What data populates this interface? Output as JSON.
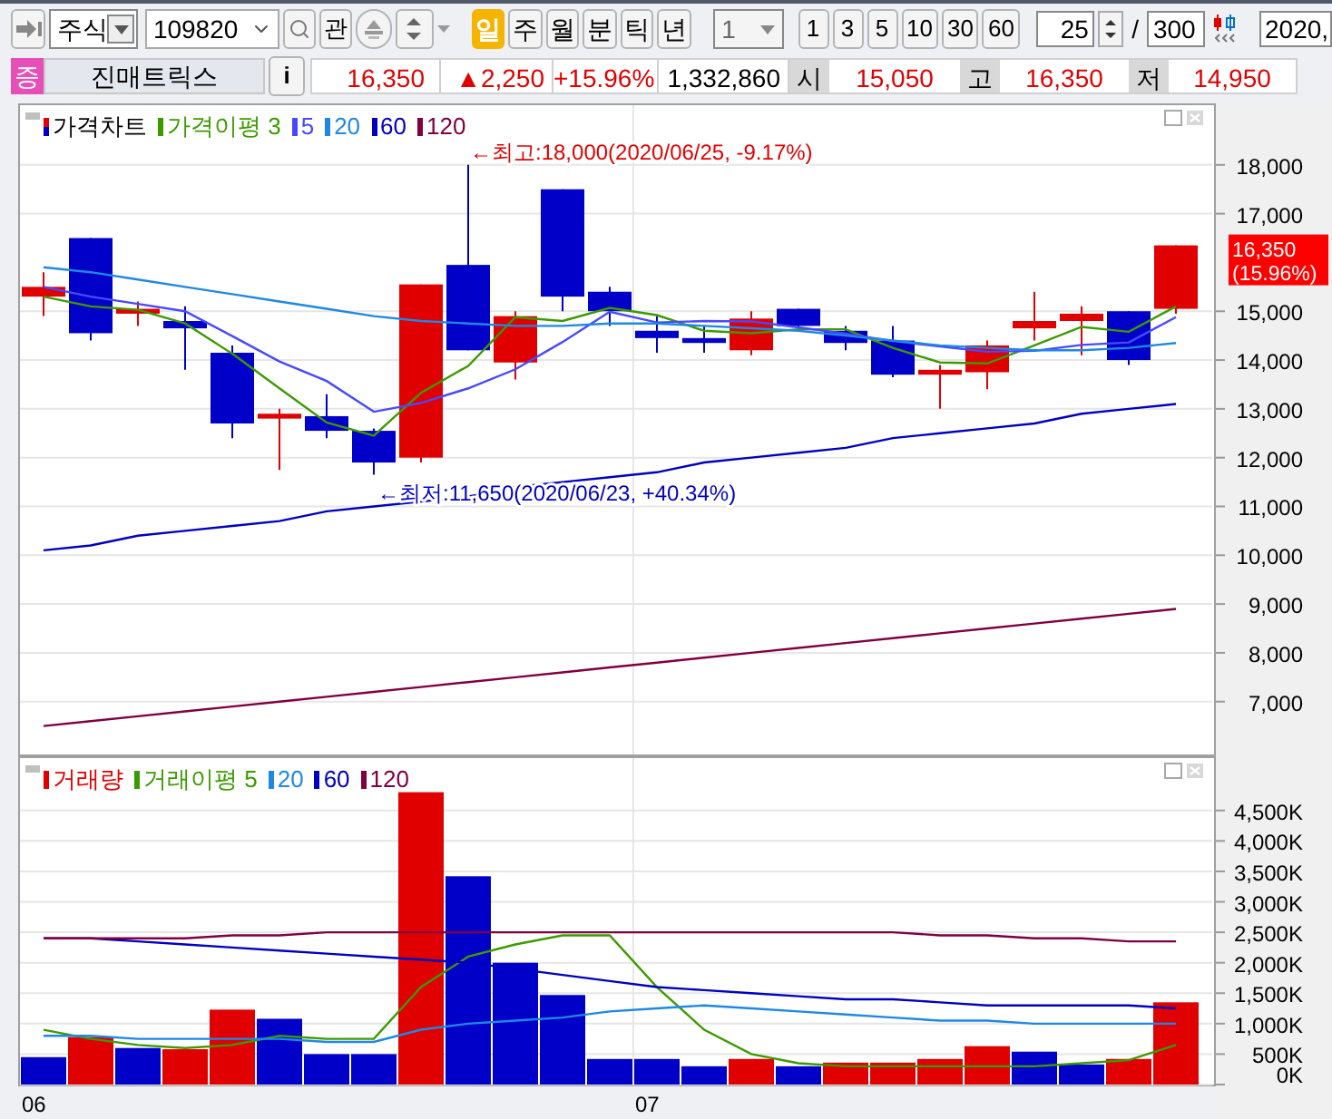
{
  "toolbar": {
    "market": "주식",
    "code": "109820",
    "watch_button": "관",
    "periods": [
      {
        "label": "일",
        "selected": true
      },
      {
        "label": "주",
        "selected": false
      },
      {
        "label": "월",
        "selected": false
      },
      {
        "label": "분",
        "selected": false
      },
      {
        "label": "틱",
        "selected": false
      },
      {
        "label": "년",
        "selected": false
      }
    ],
    "unit": "1",
    "intervals": [
      "1",
      "3",
      "5",
      "10",
      "30",
      "60"
    ],
    "count": "25",
    "separator": "/",
    "total": "300",
    "date": "2020,"
  },
  "quote": {
    "badge": "증",
    "name": "진매트릭스",
    "info_button": "i",
    "price": "16,350",
    "change": "▲2,250",
    "change_rate": "+15.96%",
    "volume": "1,332,860",
    "open_label": "시",
    "open": "15,050",
    "high_label": "고",
    "high": "16,350",
    "low_label": "저",
    "low": "14,950"
  },
  "price_panel": {
    "current_price": "16,350",
    "current_rate": "(15.96%)",
    "chart_data": {
      "type": "line",
      "grid": true,
      "legend": "upper left",
      "series": [
        {
          "name": "가격차트",
          "type": "candlestick",
          "colors": [
            "#e00000",
            "#0000c8",
            "#e00000",
            "#0000c8",
            "#0000c8",
            "#e00000",
            "#0000c8",
            "#0000c8",
            "#e00000",
            "#0000c8",
            "#e00000",
            "#0000c8",
            "#0000c8",
            "#0000c8",
            "#0000c8",
            "#e00000",
            "#0000c8",
            "#0000c8",
            "#0000c8",
            "#e00000",
            "#e00000",
            "#e00000",
            "#e00000",
            "#0000c8",
            "#e00000"
          ],
          "ohlc": [
            [
              15300,
              15800,
              14900,
              15500
            ],
            [
              16500,
              16500,
              14400,
              14550
            ],
            [
              14950,
              15200,
              14700,
              15050
            ],
            [
              14800,
              15100,
              13800,
              14650
            ],
            [
              14150,
              14300,
              12400,
              12700
            ],
            [
              12800,
              13000,
              11750,
              12900
            ],
            [
              12850,
              13300,
              12400,
              12550
            ],
            [
              12550,
              12600,
              11650,
              11900
            ],
            [
              12000,
              15550,
              11900,
              15550
            ],
            [
              15950,
              18000,
              14200,
              14200
            ],
            [
              13950,
              15000,
              13600,
              14900
            ],
            [
              17500,
              17500,
              15000,
              15300
            ],
            [
              15400,
              15500,
              14700,
              15000
            ],
            [
              14600,
              14900,
              14150,
              14450
            ],
            [
              14450,
              14700,
              14150,
              14350
            ],
            [
              14200,
              15000,
              14100,
              14850
            ],
            [
              15050,
              15050,
              14650,
              14700
            ],
            [
              14600,
              14700,
              14200,
              14350
            ],
            [
              14400,
              14700,
              13650,
              13700
            ],
            [
              13700,
              13900,
              13000,
              13800
            ],
            [
              13750,
              14400,
              13400,
              14300
            ],
            [
              14650,
              15400,
              14400,
              14800
            ],
            [
              14800,
              15100,
              14100,
              14950
            ],
            [
              15000,
              15000,
              13900,
              14000
            ],
            [
              15050,
              16350,
              14950,
              16350
            ]
          ]
        },
        {
          "name": "가격이평 3",
          "color": "#3c9a00",
          "values": [
            15300,
            15100,
            15030,
            14750,
            14130,
            13420,
            12720,
            12450,
            13330,
            13880,
            14880,
            14800,
            15070,
            14920,
            14600,
            14550,
            14630,
            14630,
            14250,
            13950,
            13930,
            14300,
            14680,
            14580,
            15100
          ]
        },
        {
          "name": "5",
          "color": "#4848ff",
          "values": [
            15500,
            15300,
            15150,
            15000,
            14490,
            13970,
            13570,
            12940,
            13120,
            13420,
            13810,
            14370,
            14990,
            14770,
            14800,
            14790,
            14670,
            14540,
            14390,
            14280,
            14170,
            14190,
            14310,
            14360,
            14880
          ]
        },
        {
          "name": "20",
          "color": "#1e88e5",
          "values": [
            15900,
            15800,
            15650,
            15500,
            15350,
            15200,
            15050,
            14900,
            14800,
            14750,
            14700,
            14700,
            14750,
            14750,
            14700,
            14650,
            14600,
            14500,
            14400,
            14300,
            14250,
            14200,
            14200,
            14250,
            14350
          ]
        },
        {
          "name": "60",
          "color": "#0000c0",
          "values": [
            10100,
            10200,
            10400,
            10500,
            10600,
            10700,
            10900,
            11000,
            11100,
            11200,
            11400,
            11500,
            11600,
            11700,
            11900,
            12000,
            12100,
            12200,
            12400,
            12500,
            12600,
            12700,
            12900,
            13000,
            13100
          ]
        },
        {
          "name": "120",
          "color": "#800040",
          "values": [
            6500,
            6600,
            6700,
            6800,
            6900,
            7000,
            7100,
            7200,
            7300,
            7400,
            7500,
            7600,
            7700,
            7800,
            7900,
            8000,
            8100,
            8200,
            8300,
            8400,
            8500,
            8600,
            8700,
            8800,
            8900
          ]
        }
      ],
      "ylim": [
        5880,
        19260
      ],
      "yticks": [
        {
          "value": 18000,
          "label": "18,000"
        },
        {
          "value": 17000,
          "label": "17,000"
        },
        {
          "value": 15000,
          "label": "15,000"
        },
        {
          "value": 14000,
          "label": "14,000"
        },
        {
          "value": 13000,
          "label": "13,000"
        },
        {
          "value": 12000,
          "label": "12,000"
        },
        {
          "value": 11000,
          "label": "11,000"
        },
        {
          "value": 10000,
          "label": "10,000"
        },
        {
          "value": 9000,
          "label": "9,000"
        },
        {
          "value": 8000,
          "label": "8,000"
        },
        {
          "value": 7000,
          "label": "7,000"
        }
      ],
      "annotations": [
        "←최고:18,000(2020/06/25, -9.17%)",
        "←최저:11,650(2020/06/23, +40.34%)"
      ]
    }
  },
  "volume_panel": {
    "date_labels": [
      "06",
      "07"
    ],
    "chart_data": {
      "type": "bar",
      "grid": true,
      "legend": "upper left",
      "series": [
        {
          "name": "거래량",
          "color": "#e00000",
          "colors": [
            "#0000c8",
            "#e00000",
            "#0000c8",
            "#e00000",
            "#e00000",
            "#0000c8",
            "#0000c8",
            "#0000c8",
            "#e00000",
            "#0000c8",
            "#0000c8",
            "#0000c8",
            "#0000c8",
            "#0000c8",
            "#0000c8",
            "#e00000",
            "#0000c8",
            "#e00000",
            "#e00000",
            "#e00000",
            "#e00000",
            "#0000c8",
            "#0000c8",
            "#e00000",
            "#e00000"
          ],
          "values": [
            450,
            780,
            600,
            580,
            1230,
            1080,
            500,
            500,
            4800,
            3420,
            2000,
            1470,
            420,
            420,
            300,
            420,
            300,
            360,
            360,
            420,
            630,
            540,
            330,
            420,
            1350
          ]
        },
        {
          "name": "거래이평 5",
          "type": "line",
          "color": "#3c9a00",
          "values": [
            900,
            750,
            650,
            600,
            650,
            800,
            750,
            750,
            1600,
            2100,
            2300,
            2450,
            2450,
            1600,
            900,
            500,
            350,
            300,
            300,
            300,
            300,
            300,
            350,
            400,
            650
          ]
        },
        {
          "name": "20",
          "type": "line",
          "color": "#1e88e5",
          "values": [
            800,
            800,
            750,
            750,
            750,
            750,
            700,
            700,
            900,
            1000,
            1050,
            1100,
            1200,
            1250,
            1300,
            1250,
            1200,
            1150,
            1100,
            1050,
            1050,
            1000,
            1000,
            1000,
            1000
          ]
        },
        {
          "name": "60",
          "type": "line",
          "color": "#0000c0",
          "values": [
            2400,
            2400,
            2350,
            2300,
            2250,
            2200,
            2150,
            2100,
            2050,
            2000,
            1900,
            1800,
            1700,
            1600,
            1550,
            1500,
            1450,
            1400,
            1400,
            1350,
            1300,
            1300,
            1300,
            1300,
            1250
          ]
        },
        {
          "name": "120",
          "type": "line",
          "color": "#800040",
          "values": [
            2400,
            2400,
            2400,
            2400,
            2450,
            2450,
            2500,
            2500,
            2500,
            2500,
            2500,
            2500,
            2500,
            2500,
            2500,
            2500,
            2500,
            2500,
            2500,
            2450,
            2450,
            2400,
            2400,
            2350,
            2350
          ]
        }
      ],
      "ylim": [
        0,
        5390
      ],
      "yticks": [
        {
          "value": 4500,
          "label": "4,500K"
        },
        {
          "value": 4000,
          "label": "4,000K"
        },
        {
          "value": 3500,
          "label": "3,500K"
        },
        {
          "value": 3000,
          "label": "3,000K"
        },
        {
          "value": 2500,
          "label": "2,500K"
        },
        {
          "value": 2000,
          "label": "2,000K"
        },
        {
          "value": 1500,
          "label": "1,500K"
        },
        {
          "value": 1000,
          "label": "1,000K"
        },
        {
          "value": 500,
          "label": "500K"
        },
        {
          "value": 0,
          "label": "0K"
        }
      ]
    }
  }
}
